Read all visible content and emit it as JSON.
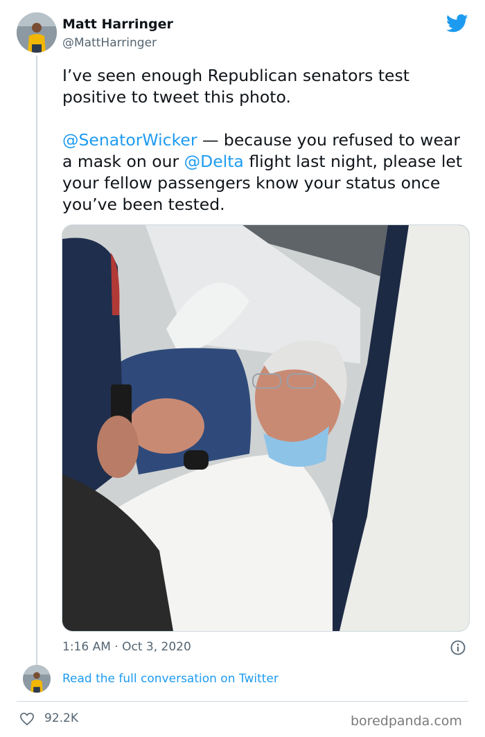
{
  "author": {
    "name": "Matt Harringer",
    "handle": "@MattHarringer"
  },
  "tweet": {
    "line1": "I’ve seen enough Republican senators test positive to tweet this photo.",
    "mention1": "@SenatorWicker",
    "text2a": " — because you refused to wear a mask on our ",
    "mention2": "@Delta",
    "text2b": " flight last night, please let your fellow passengers know your status once you’ve been tested."
  },
  "timestamp": "1:16 AM · Oct 3, 2020",
  "read_link": "Read the full conversation on Twitter",
  "likes": "92.2K",
  "watermark": "boredpanda.com",
  "colors": {
    "accent": "#1d9bf0",
    "secondary_text": "#536471"
  },
  "icons": [
    "twitter-bird-icon",
    "info-icon",
    "heart-icon"
  ]
}
